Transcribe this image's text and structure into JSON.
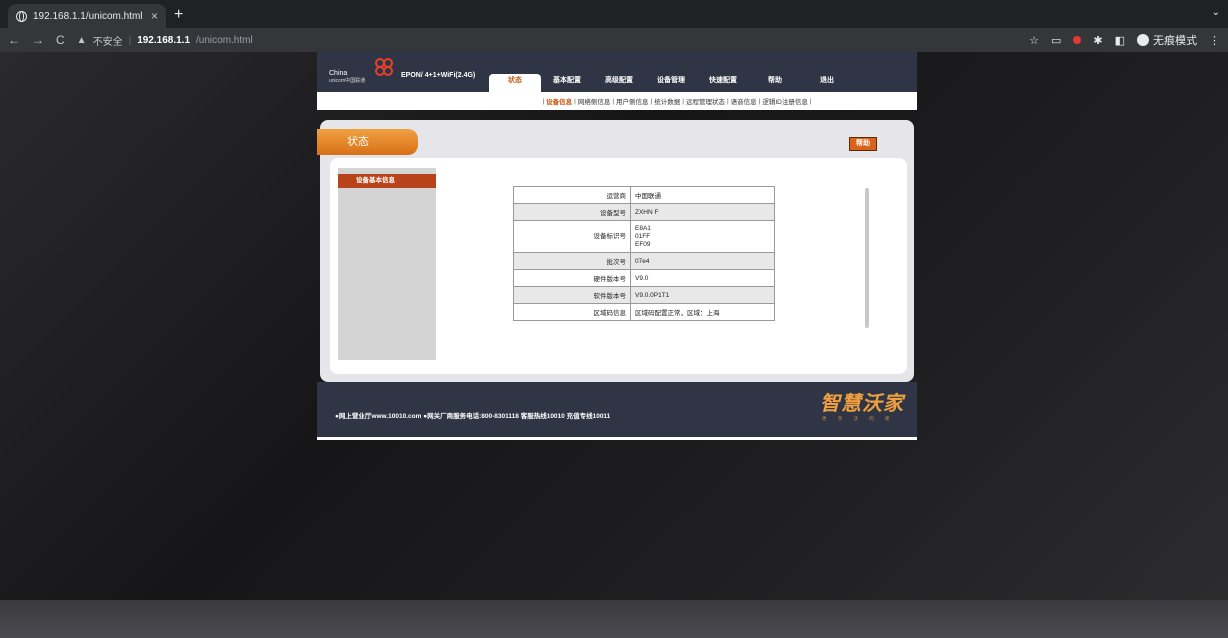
{
  "browser": {
    "tab_title": "192.168.1.1/unicom.html",
    "tab_close": "×",
    "new_tab": "+",
    "url_warning": "不安全",
    "url_host": "192.168.1.1",
    "url_path": "/unicom.html",
    "incognito_label": "无痕模式"
  },
  "router": {
    "logo_text": "China unicom中国联通",
    "logo_en": "China",
    "logo_sub": "unicom中国联通",
    "model": "EPON/ 4+1+WiFi(2.4G)",
    "nav": [
      {
        "label": "状态",
        "active": true
      },
      {
        "label": "基本配置",
        "active": false
      },
      {
        "label": "高级配置",
        "active": false
      },
      {
        "label": "设备管理",
        "active": false
      },
      {
        "label": "快速配置",
        "active": false
      },
      {
        "label": "帮助",
        "active": false
      },
      {
        "label": "退出",
        "active": false
      }
    ],
    "subnav": [
      {
        "label": "设备信息",
        "active": true
      },
      {
        "label": "网络侧信息",
        "active": false
      },
      {
        "label": "用户侧信息",
        "active": false
      },
      {
        "label": "统计数据",
        "active": false
      },
      {
        "label": "远程管理状态",
        "active": false
      },
      {
        "label": "语音信息",
        "active": false
      },
      {
        "label": "逻辑ID注册信息",
        "active": false
      }
    ],
    "section_title": "状态",
    "help_button": "帮助",
    "sidebar_item": "设备基本信息",
    "table": [
      {
        "key": "运营商",
        "value": "中国联通"
      },
      {
        "key": "设备型号",
        "value": "ZXHN F"
      },
      {
        "key": "设备标识号",
        "value": "E8A1\n01FF\nEF09"
      },
      {
        "key": "批次号",
        "value": "07e4"
      },
      {
        "key": "硬件版本号",
        "value": "V9.0"
      },
      {
        "key": "软件版本号",
        "value": "V9.0.0P1T1"
      },
      {
        "key": "区域码信息",
        "value": "区域码配置正常，区域：上海"
      }
    ],
    "footer_note": "●网上营业厅www.10010.com ●网关厂商服务电话:800-8301118 客服热线10010 充值专线10011",
    "brand": "智慧沃家",
    "brand_slogan": "更 享 沃 的 家"
  },
  "colors": {
    "accent_orange": "#c85a14",
    "header_navy": "#2f3544"
  }
}
